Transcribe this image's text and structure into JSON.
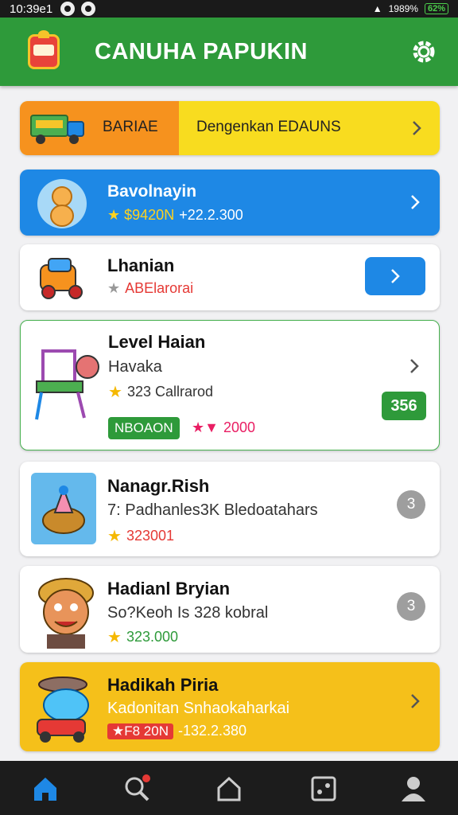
{
  "status": {
    "time": "10:39e1",
    "battery": "62%",
    "signal": "1989%"
  },
  "appbar": {
    "title": "CANUHA PAPUKIN"
  },
  "banner": {
    "label": "BARIAE",
    "message": "Dengenkan EDAUNS"
  },
  "cards": [
    {
      "title": "Bavolnayin",
      "rating": "★ $9420N",
      "price": "+22.2.300"
    },
    {
      "title": "Lhanian",
      "rating": "ABElarorai"
    },
    {
      "title": "Level Haian",
      "subtitle": "Havaka",
      "rating": "323 Callrarod",
      "badge": "356",
      "tag": "NBOAON",
      "price": "2000"
    },
    {
      "title": "Nanagr.Rish",
      "subtitle": "7: Padhanles3K Bledoatahars",
      "rating": "323001",
      "count": "3"
    },
    {
      "title": "Hadianl Bryian",
      "subtitle": "So?Keoh Is 328 kobral",
      "rating": "323.000",
      "count": "3"
    },
    {
      "title": "Hadikah Piria",
      "subtitle": "Kadonitan Snhaokaharkai",
      "tag": "F8 20N",
      "price": "-132.2.380"
    }
  ],
  "colors": {
    "green": "#2e9a3a",
    "blue": "#1e88e5",
    "orange": "#f6921e",
    "yellow": "#f8dc1f",
    "gold": "#f5c01a"
  },
  "nav": [
    "home-icon",
    "search-icon",
    "house-icon",
    "puzzle-icon",
    "profile-icon"
  ]
}
